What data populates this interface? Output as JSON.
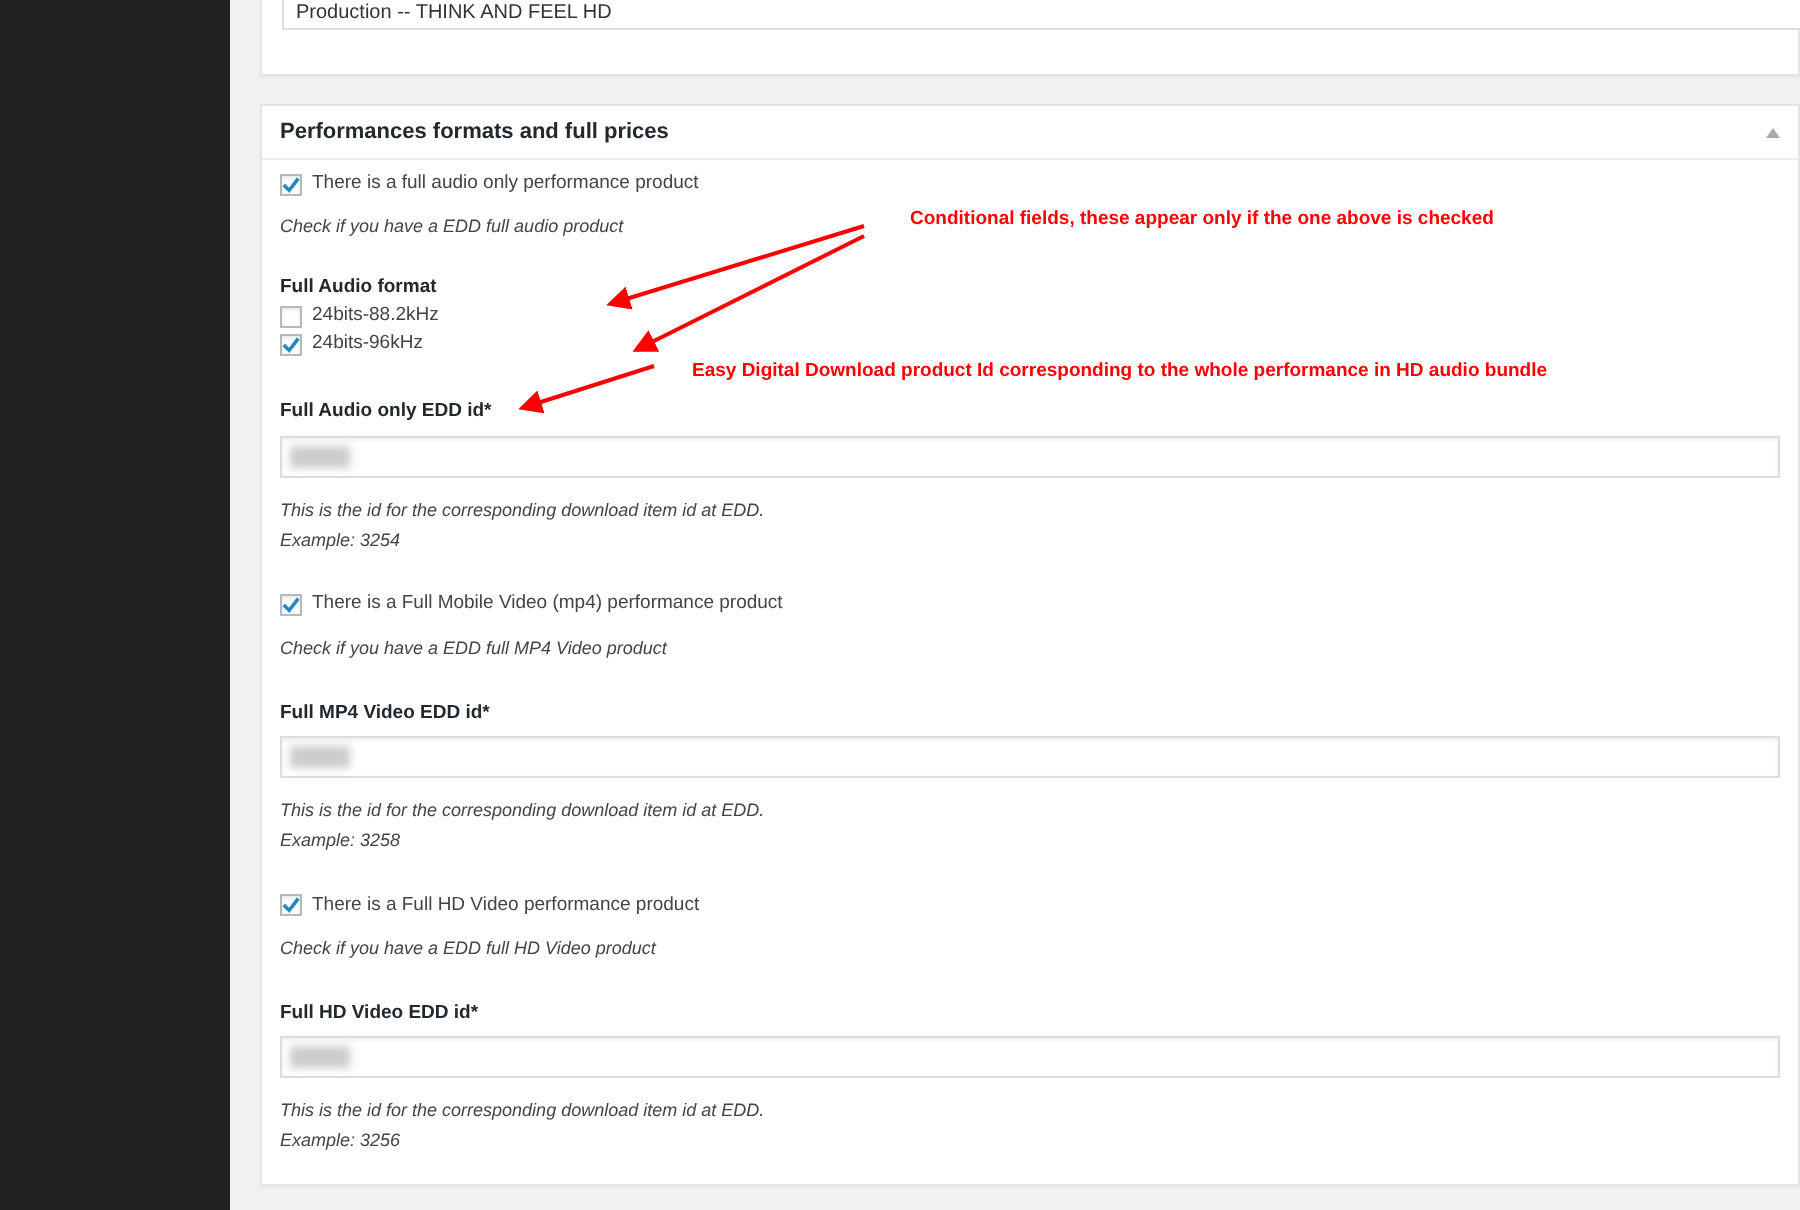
{
  "top_textarea": {
    "value": "Production -- THINK AND FEEL HD"
  },
  "panel": {
    "title": "Performances formats and full prices",
    "groups": [
      {
        "kind": "checkbox",
        "label": "There is a full audio only performance product",
        "checked": true,
        "help": "Check if you have a EDD full audio product"
      },
      {
        "kind": "checklist",
        "label": "Full Audio format",
        "options": [
          {
            "label": "24bits-88.2kHz",
            "checked": false
          },
          {
            "label": "24bits-96kHz",
            "checked": true
          }
        ]
      },
      {
        "kind": "text",
        "label": "Full Audio only EDD id*",
        "value_redacted": true,
        "help_lines": [
          "This is the id for the corresponding download item id at EDD.",
          "Example: 3254"
        ]
      },
      {
        "kind": "checkbox",
        "label": "There is a Full Mobile Video (mp4) performance product",
        "checked": true,
        "help": "Check if you have a EDD full MP4 Video product"
      },
      {
        "kind": "text",
        "label": "Full MP4 Video EDD id*",
        "value_redacted": true,
        "help_lines": [
          "This is the id for the corresponding download item id at EDD.",
          "Example: 3258"
        ]
      },
      {
        "kind": "checkbox",
        "label": "There is a Full HD Video performance product",
        "checked": true,
        "help": "Check if you have a EDD full HD Video product"
      },
      {
        "kind": "text",
        "label": "Full HD Video EDD id*",
        "value_redacted": true,
        "help_lines": [
          "This is the id for the corresponding download item id at EDD.",
          "Example: 3256"
        ]
      }
    ]
  },
  "annotations": [
    {
      "text": "Conditional fields, these appear only if the one above is checked"
    },
    {
      "text": "Easy Digital Download product Id corresponding to the whole performance in HD audio bundle"
    }
  ]
}
